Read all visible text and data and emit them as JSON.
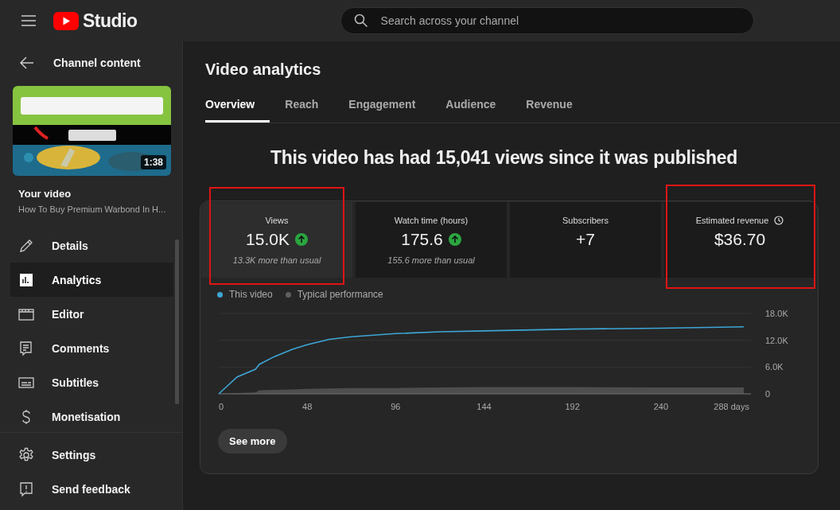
{
  "header": {
    "logo_text": "Studio",
    "search": {
      "placeholder": "Search across your channel"
    }
  },
  "sidebar": {
    "back_label": "Channel content",
    "thumbnail": {
      "kind": "picture",
      "duration": "1:38"
    },
    "video_heading": "Your video",
    "video_title": "How To Buy Premium Warbond In H...",
    "items": [
      {
        "label": "Details",
        "selected": false
      },
      {
        "label": "Analytics",
        "selected": true
      },
      {
        "label": "Editor",
        "selected": false
      },
      {
        "label": "Comments",
        "selected": false
      },
      {
        "label": "Subtitles",
        "selected": false
      },
      {
        "label": "Monetisation",
        "selected": false
      }
    ],
    "footer_items": [
      {
        "label": "Settings"
      },
      {
        "label": "Send feedback"
      }
    ]
  },
  "main": {
    "title": "Video analytics",
    "tabs": [
      {
        "label": "Overview",
        "selected": true
      },
      {
        "label": "Reach",
        "selected": false
      },
      {
        "label": "Engagement",
        "selected": false
      },
      {
        "label": "Audience",
        "selected": false
      },
      {
        "label": "Revenue",
        "selected": false
      }
    ],
    "headline": "This video has had 15,041 views since it was published",
    "stats": [
      {
        "label": "Views",
        "value": "15.0K",
        "trend_up": true,
        "note": "13.3K more than usual",
        "selected": true,
        "highlighted": true
      },
      {
        "label": "Watch time (hours)",
        "value": "175.6",
        "trend_up": true,
        "note": "155.6 more than usual",
        "selected": false
      },
      {
        "label": "Subscribers",
        "value": "+7",
        "selected": false
      },
      {
        "label": "Estimated revenue",
        "value": "$36.70",
        "selected": false,
        "highlighted": true,
        "clock": true
      }
    ],
    "chart_data": {
      "type": "line",
      "x": [
        0,
        10,
        20,
        22,
        30,
        40,
        48,
        60,
        72,
        96,
        120,
        144,
        192,
        240,
        285
      ],
      "xlim": [
        0,
        288
      ],
      "ylim": [
        0,
        18000
      ],
      "xticks": [
        0,
        48,
        96,
        144,
        192,
        240,
        {
          "value": 288,
          "label": "288 days"
        }
      ],
      "yticks": [
        0,
        {
          "value": 6000,
          "label": "6.0K"
        },
        {
          "value": 12000,
          "label": "12.0K"
        },
        {
          "value": 18000,
          "label": "18.0K"
        }
      ],
      "series": [
        {
          "name": "This video",
          "color": "#3ea6d6",
          "values": [
            0,
            3800,
            5500,
            6600,
            8300,
            10000,
            11000,
            12200,
            12800,
            13500,
            13900,
            14100,
            14500,
            14700,
            15000
          ]
        },
        {
          "name": "Typical performance",
          "type": "area",
          "color": "#5f5f5f",
          "values": [
            0,
            200,
            300,
            800,
            900,
            1000,
            1100,
            1200,
            1300,
            1300,
            1400,
            1500,
            1500,
            1400,
            1400
          ]
        }
      ]
    },
    "see_more": "See more"
  }
}
